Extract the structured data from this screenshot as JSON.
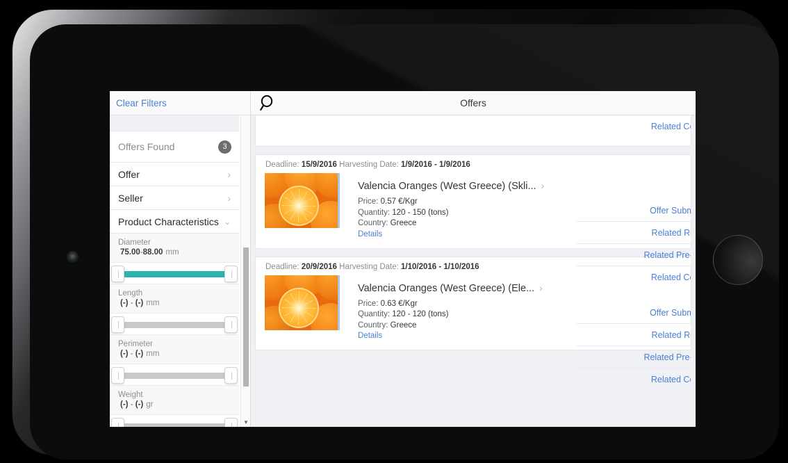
{
  "sidebar": {
    "clear_filters": "Clear Filters",
    "offers_found_label": "Offers Found",
    "offers_found_count": "3",
    "groups": [
      {
        "label": "Offer",
        "icon": "chevron-right-icon"
      },
      {
        "label": "Seller",
        "icon": "chevron-right-icon"
      },
      {
        "label": "Product Characteristics",
        "icon": "chevron-down-icon"
      }
    ],
    "facets": [
      {
        "name": "Diameter",
        "min": "75.00",
        "dash": "-",
        "max": "88.00",
        "unit": "mm",
        "active": true
      },
      {
        "name": "Length",
        "min": "(-)",
        "dash": "-",
        "max": "(-)",
        "unit": "mm",
        "active": false
      },
      {
        "name": "Perimeter",
        "min": "(-)",
        "dash": "-",
        "max": "(-)",
        "unit": "mm",
        "active": false
      },
      {
        "name": "Weight",
        "min": "(-)",
        "dash": "-",
        "max": "(-)",
        "unit": "gr",
        "active": false
      }
    ],
    "scroll_down_icon": "scroll-down-arrow-icon"
  },
  "topbar": {
    "title": "Offers",
    "search_icon": "search-icon"
  },
  "links": {
    "offer_submission": "Offer Submiss",
    "related_request": "Related Requ",
    "related_precontract": "Related Pre-cor",
    "related_contract": "Related Contr"
  },
  "cards": [
    {
      "deadline_label": "Deadline:",
      "deadline_value": "15/9/2016",
      "harvest_label": "Harvesting Date:",
      "harvest_value": "1/9/2016 - 1/9/2016",
      "title": "Valencia Oranges (West Greece) (Skli...",
      "arrow_icon": "chevron-right-icon",
      "price_key": "Price:",
      "price_value": "0.57 €/Kgr",
      "quantity_key": "Quantity:",
      "quantity_value": "120 - 150 (tons)",
      "country_key": "Country:",
      "country_value": "Greece",
      "details": "Details"
    },
    {
      "deadline_label": "Deadline:",
      "deadline_value": "20/9/2016",
      "harvest_label": "Harvesting Date:",
      "harvest_value": "1/10/2016 - 1/10/2016",
      "title": "Valencia Oranges (West Greece) (Ele...",
      "arrow_icon": "chevron-right-icon",
      "price_key": "Price:",
      "price_value": "0.63 €/Kgr",
      "quantity_key": "Quantity:",
      "quantity_value": "120 - 120 (tons)",
      "country_key": "Country:",
      "country_value": "Greece",
      "details": "Details"
    }
  ],
  "colors": {
    "accent_link": "#4a7fd4",
    "slider_active": "#2bb3ad",
    "app_bg": "#eff1f4",
    "text_primary": "#32363a",
    "text_muted": "#8a8d91"
  }
}
